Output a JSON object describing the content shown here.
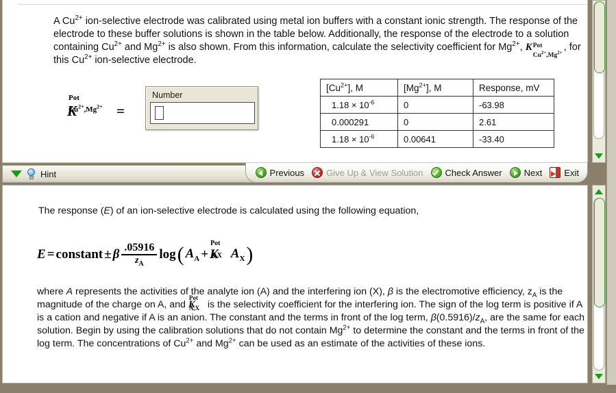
{
  "question": {
    "line1_a": "A Cu",
    "line1_sup": "2+",
    "line1_b": " ion-selective electrode was calibrated using metal ion buffers with a constant ionic strength. The response of the electrode to these buffer solutions is shown in the table below. Additionally, the response of the electrode to a solution containing Cu",
    "line2_sup": "2+",
    "line2_b": " and Mg",
    "line3_sup": "2+",
    "line3_b": " is also shown. From this information, calculate the selectivity coefficient for Mg",
    "line4_sup": "2+",
    "line4_b": ", ",
    "line5_b": ", for this Cu",
    "line5_sup": "2+",
    "line6_b": " ion-selective electrode.",
    "k_symbol": {
      "base": "K",
      "superscript": "Pot",
      "subscript_cu": "Cu",
      "subscript_cu_charge": "2+",
      "subscript_sep": ",",
      "subscript_mg": "Mg",
      "subscript_mg_charge": "2+"
    }
  },
  "answer": {
    "k_label": {
      "base": "K",
      "superscript": "Pot",
      "sub_cu": "Cu",
      "sub_cu_charge": "2+",
      "sep": ",",
      "sub_mg": "Mg",
      "sub_mg_charge": "2+"
    },
    "equals": "=",
    "box_label": "Number",
    "value": "",
    "placeholder": ""
  },
  "table": {
    "headers": [
      {
        "pre": "[Cu",
        "sup": "2+",
        "post": "], M"
      },
      {
        "pre": "[Mg",
        "sup": "2+",
        "post": "], M"
      },
      {
        "pre": "Response, mV",
        "sup": "",
        "post": ""
      }
    ],
    "rows": [
      {
        "cu_mantissa": "1.18 × 10",
        "cu_exp": "-6",
        "cu_plain": "",
        "mg": "0",
        "response": "-63.98"
      },
      {
        "cu_mantissa": "",
        "cu_exp": "",
        "cu_plain": "0.000291",
        "mg": "0",
        "response": "2.61"
      },
      {
        "cu_mantissa": "1.18 × 10",
        "cu_exp": "-6",
        "cu_plain": "",
        "mg": "0.00641",
        "response": "-33.40"
      }
    ]
  },
  "toolbar": {
    "hint_label": "Hint",
    "previous_label": "Previous",
    "giveup_label": "Give Up & View Solution",
    "giveup_disabled": true,
    "check_label": "Check Answer",
    "next_label": "Next",
    "exit_label": "Exit"
  },
  "hint": {
    "intro_a": "The response (",
    "intro_em": "E",
    "intro_b": ") of an ion-selective electrode is calculated using the following equation,",
    "equation": {
      "lhs": "E",
      "eq": "=",
      "constant": "constant",
      "pm": "±",
      "beta": "β",
      "numerator": ".05916",
      "denominator": "z",
      "denominator_sub": "A",
      "log": "log",
      "open": "(",
      "a_analyte": "A",
      "a_analyte_sub": "A",
      "plus": "+",
      "k_base": "K",
      "k_sup": "Pot",
      "k_sub": "A,X",
      "a_interfere": "A",
      "a_interfere_sub": "X",
      "close": ")"
    },
    "body_1": "where ",
    "body_1_em": "A",
    "body_2": " represents the activities of the analyte ion (A) and the interfering ion (X), ",
    "body_beta": "β",
    "body_3": " is the electromotive efficiency, ",
    "body_z": "z",
    "body_z_sub": "A",
    "body_4": " is the magnitude of the charge on A, and ",
    "body_k": {
      "base": "K",
      "sup": "Pot",
      "sub": "A,X"
    },
    "body_5": " is the selectivity coefficient for the interfering ion. The sign of the log term is positive if A is a cation and negative if A is an anion. The constant and the terms in front of the log term, ",
    "body_beta2": "β",
    "body_6": "(0.5916)/",
    "body_z2": "z",
    "body_z2_sub": "A",
    "body_7": ", are the same for each solution. Begin by using the calibration solutions that do not contain Mg",
    "body_sup1": "2+",
    "body_8": " to determine the constant and the terms in front of the log term. The concentrations of Cu",
    "body_sup2": "2+",
    "body_9": " and Mg",
    "body_sup3": "2+",
    "body_10": " can be used as an estimate of the activities of these ions."
  },
  "colors": {
    "accent_green": "#1a9e1a",
    "toolbar_bg": "#e9e8da",
    "input_panel_bg": "#e8e6d6",
    "frame_brown": "#8a7f6a"
  }
}
